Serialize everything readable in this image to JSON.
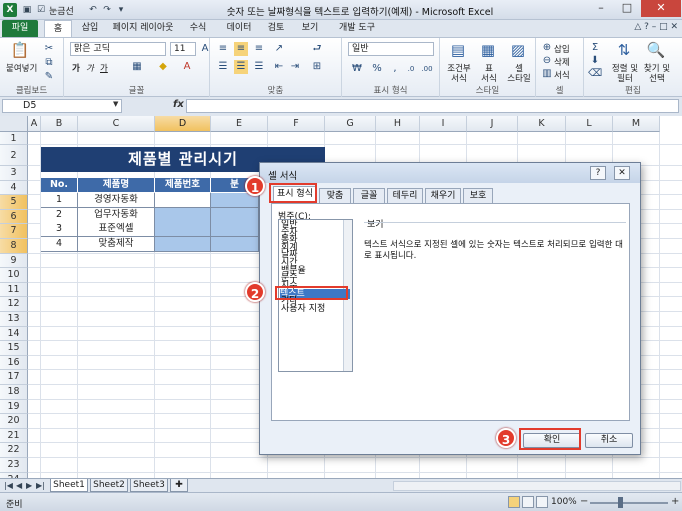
{
  "window": {
    "title": "숫자 또는 날짜형식을 텍스트로 입력하기(예제) - Microsoft Excel",
    "qat_label": "눈금선",
    "logo": "X",
    "min": "–",
    "max": "□",
    "close": "✕"
  },
  "tabs": [
    "파일",
    "홈",
    "삽입",
    "페이지 레이아웃",
    "수식",
    "데이터",
    "검토",
    "보기",
    "개발 도구"
  ],
  "ribbon": {
    "clipboard": {
      "label": "클립보드",
      "paste": "붙여넣기"
    },
    "font": {
      "label": "글꼴",
      "name": "맑은 고딕",
      "size": "11",
      "bold": "가",
      "italic": "가",
      "underline": "가"
    },
    "align": {
      "label": "맞춤"
    },
    "number": {
      "label": "표시 형식",
      "format": "일반"
    },
    "styles": {
      "label": "스타일",
      "cond": "조건부\n서식",
      "table": "표\n서식",
      "cell": "셀\n스타일"
    },
    "cells": {
      "label": "셀",
      "insert": "삽입",
      "delete": "삭제",
      "format": "서식"
    },
    "edit": {
      "label": "편집",
      "sort": "정렬 및\n필터",
      "find": "찾기 및\n선택"
    }
  },
  "formula_bar": {
    "name_box": "D5",
    "fx": "fx",
    "value": ""
  },
  "columns": [
    "A",
    "B",
    "C",
    "D",
    "E",
    "F",
    "G",
    "H",
    "I",
    "J",
    "K",
    "L",
    "M"
  ],
  "rows": [
    "1",
    "2",
    "3",
    "4",
    "5",
    "6",
    "7",
    "8",
    "9",
    "10",
    "11",
    "12",
    "13",
    "14",
    "15",
    "16",
    "17",
    "18",
    "19",
    "20",
    "21",
    "22",
    "23",
    "24"
  ],
  "sheet": {
    "title": "제품별 관리시기",
    "headers": [
      "No.",
      "제품명",
      "제품번호",
      "분"
    ],
    "rows": [
      {
        "no": "1",
        "name": "경영자동화"
      },
      {
        "no": "2",
        "name": "업무자동화"
      },
      {
        "no": "3",
        "name": "표준엑셀"
      },
      {
        "no": "4",
        "name": "맞춤제작"
      }
    ]
  },
  "dialog": {
    "title": "셀 서식",
    "help": "?",
    "close": "✕",
    "tabs": [
      "표시 형식",
      "맞춤",
      "글꼴",
      "테두리",
      "채우기",
      "보호"
    ],
    "category_label": "범주(C):",
    "categories": [
      "일반",
      "숫자",
      "통화",
      "회계",
      "날짜",
      "시간",
      "백분율",
      "분수",
      "지수",
      "텍스트",
      "기타",
      "사용자 지정"
    ],
    "preview_label": "보기",
    "description": "텍스트 서식으로 지정된 셀에 있는 숫자는 텍스트로 처리되므로 입력한 대로 표시됩니다.",
    "ok": "확인",
    "cancel": "취소"
  },
  "callouts": [
    "1",
    "2",
    "3"
  ],
  "sheet_tabs": [
    "Sheet1",
    "Sheet2",
    "Sheet3"
  ],
  "status": {
    "text": "준비",
    "zoom": "100%",
    "minus": "−",
    "plus": "+"
  },
  "colors": {
    "accent": "#1f7a3c",
    "title_fill": "#1f3f73",
    "header_fill": "#3e6aa8",
    "selected_fill": "#a9c7ea",
    "callout": "#e23b2c"
  }
}
